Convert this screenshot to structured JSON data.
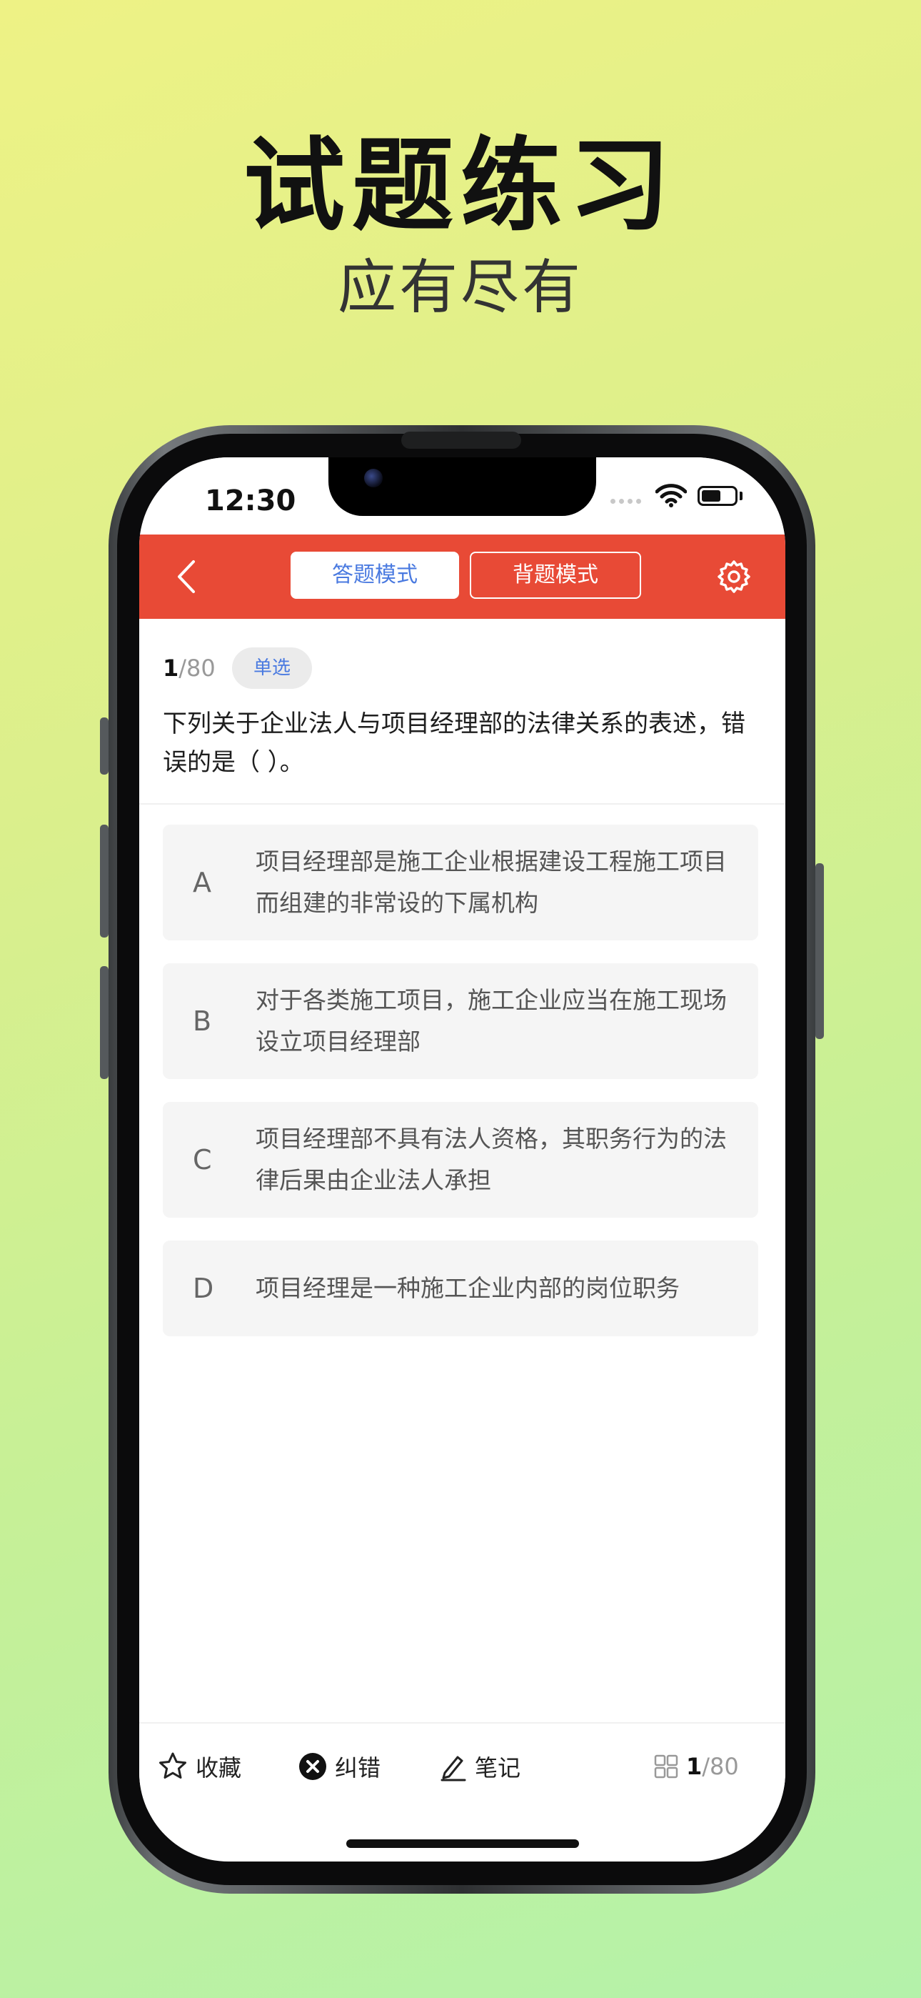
{
  "promo": {
    "title": "试题练习",
    "subtitle": "应有尽有"
  },
  "status_bar": {
    "time": "12:30",
    "battery_level": 0.6
  },
  "header": {
    "tabs": [
      {
        "label": "答题模式",
        "active": true
      },
      {
        "label": "背题模式",
        "active": false
      }
    ],
    "accent_color": "#e84a36",
    "active_tab_color": "#4a7ae0"
  },
  "question": {
    "current": "1",
    "total": "/80",
    "type": "单选",
    "text": "下列关于企业法人与项目经理部的法律关系的表述，错误的是（ ）。"
  },
  "options": [
    {
      "letter": "A",
      "text": "项目经理部是施工企业根据建设工程施工项目而组建的非常设的下属机构"
    },
    {
      "letter": "B",
      "text": "对于各类施工项目，施工企业应当在施工现场设立项目经理部"
    },
    {
      "letter": "C",
      "text": "项目经理部不具有法人资格，其职务行为的法律后果由企业法人承担"
    },
    {
      "letter": "D",
      "text": "项目经理是一种施工企业内部的岗位职务"
    }
  ],
  "bottom_bar": {
    "favorite": "收藏",
    "report_error": "纠错",
    "notes": "笔记",
    "progress_current": "1",
    "progress_total": "/80"
  }
}
